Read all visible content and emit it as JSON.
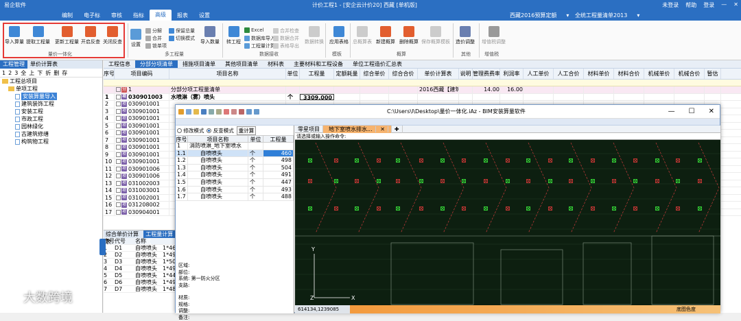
{
  "titlebar": {
    "app": "易企软件",
    "center": "计价工程1 - [安企云计价20] 西藏 [单机版]",
    "right": [
      "未登录",
      "帮助",
      "登录",
      "我的云",
      "最小化",
      "关闭"
    ]
  },
  "menubar": {
    "items": [
      "编制",
      "电子标",
      "审核",
      "指标",
      "报表",
      "设置"
    ],
    "active_index": 4,
    "active_label": "报表",
    "right_tabs": [
      "高级"
    ],
    "quota": "西藏2016预算定额",
    "list": "全统工程量清单2013"
  },
  "ribbon": {
    "group1_label": "量价一体化",
    "group1_buttons": [
      "导入算量",
      "提取工程量",
      "更新工程量",
      "开启反查",
      "关闭反查"
    ],
    "small1": [
      "分解",
      "合并",
      "锁单项"
    ],
    "setup": "设置",
    "group2_items": [
      "保留总量",
      "切换模式"
    ],
    "import_qty": "导入数量",
    "group2_label": "多工程量",
    "convert": "转工程",
    "excel_items": [
      "Excel",
      "数据库导入",
      "工程量计算",
      "合并检查",
      "数据合并",
      "表格导出"
    ],
    "group3_label": "数据接收",
    "small3": [
      "合并检查",
      "数据合并",
      "表格导出"
    ],
    "data_convert": "数据转换",
    "apply_table": "应用表格",
    "group4_label": "模板",
    "total_sheet": "总概算表",
    "new_sheet": "新建概算",
    "del_sheet": "删除概算",
    "save_sheet": "保存概算模板",
    "group5_label": "概算",
    "price_adjust": "造价调整",
    "group6_label": "其他",
    "add_cost": "增值税调整",
    "group7_label": "增值税"
  },
  "leftpanel": {
    "tabs": [
      "工程管理",
      "单价计算表"
    ],
    "tools": [
      "1",
      "2",
      "3",
      "全",
      "上",
      "下",
      "折",
      "删",
      "存"
    ],
    "tree": [
      {
        "label": "工程总项目",
        "level": 0,
        "icon": "folder-icon"
      },
      {
        "label": "单项工程",
        "level": 1,
        "icon": "folder-icon"
      },
      {
        "label": "安装算量导入",
        "level": 2,
        "icon": "doc-icon",
        "selected": true
      },
      {
        "label": "建筑装饰工程",
        "level": 2,
        "icon": "doc-icon"
      },
      {
        "label": "安装工程",
        "level": 2,
        "icon": "doc-icon"
      },
      {
        "label": "市政工程",
        "level": 2,
        "icon": "doc-icon"
      },
      {
        "label": "园林绿化",
        "level": 2,
        "icon": "doc-icon"
      },
      {
        "label": "古建筑修缮",
        "level": 2,
        "icon": "doc-icon"
      },
      {
        "label": "构筑物工程",
        "level": 2,
        "icon": "doc-icon"
      }
    ]
  },
  "main": {
    "tabs": [
      "工程信息",
      "分部分项清单",
      "措施项目清单",
      "其他项目清单",
      "材料表",
      "主要材料和工程设备",
      "单位工程造价汇总表"
    ],
    "active_tab": 1,
    "headers": [
      "序号",
      "项目编码",
      "项目名称",
      "单位",
      "工程量",
      "定额耗量",
      "综合单价",
      "综合合价",
      "单价计算表",
      "说明",
      "管理费费率",
      "利润率",
      "人工单价",
      "人工合价",
      "材料单价",
      "材料合价",
      "机械单价",
      "机械合价",
      "暂估"
    ],
    "rows": [
      {
        "no": "",
        "code": "1",
        "name": "分部分项工程量清单",
        "unit": "",
        "qty": "",
        "tag": "2016西藏【建筑装",
        "mgmt": "14.00",
        "profit": "16.00",
        "style": "pink",
        "badge": "分"
      },
      {
        "no": "1",
        "code": "030901003",
        "name": "水喷淋（雾）喷头",
        "unit": "个",
        "qty": "3309.000",
        "style": "bold",
        "badge": "项"
      },
      {
        "no": "2",
        "code": "030901001",
        "name": "",
        "unit": "",
        "qty": "",
        "badge": "项"
      },
      {
        "no": "3",
        "code": "030901001",
        "name": "",
        "unit": "",
        "qty": "",
        "badge": "项"
      },
      {
        "no": "4",
        "code": "030901001",
        "name": "",
        "unit": "",
        "qty": "",
        "badge": "项"
      },
      {
        "no": "5",
        "code": "030901001",
        "name": "",
        "unit": "",
        "qty": "",
        "badge": "项"
      },
      {
        "no": "6",
        "code": "030901001",
        "name": "",
        "unit": "",
        "qty": "",
        "badge": "项"
      },
      {
        "no": "7",
        "code": "030901001",
        "name": "",
        "unit": "",
        "qty": "",
        "badge": "项"
      },
      {
        "no": "8",
        "code": "030901001",
        "name": "",
        "unit": "",
        "qty": "",
        "badge": "项"
      },
      {
        "no": "9",
        "code": "030901001",
        "name": "",
        "unit": "",
        "qty": "",
        "badge": "项"
      },
      {
        "no": "10",
        "code": "030901001",
        "name": "",
        "unit": "",
        "qty": "",
        "badge": "项"
      },
      {
        "no": "11",
        "code": "030901006",
        "name": "",
        "unit": "",
        "qty": "",
        "badge": "项"
      },
      {
        "no": "12",
        "code": "030901006",
        "name": "",
        "unit": "",
        "qty": "",
        "badge": "项"
      },
      {
        "no": "13",
        "code": "031002003",
        "name": "",
        "unit": "",
        "qty": "",
        "badge": "项"
      },
      {
        "no": "14",
        "code": "031003001",
        "name": "",
        "unit": "",
        "qty": "",
        "badge": "项"
      },
      {
        "no": "15",
        "code": "031002001",
        "name": "",
        "unit": "",
        "qty": "",
        "badge": "项"
      },
      {
        "no": "16",
        "code": "031208002",
        "name": "",
        "unit": "",
        "qty": "",
        "badge": "项"
      },
      {
        "no": "17",
        "code": "030904001",
        "name": "",
        "unit": "",
        "qty": "",
        "badge": "项"
      }
    ]
  },
  "bottomleft": {
    "tabs": [
      "综合单价计算表",
      "工程量计算式"
    ],
    "headers": [
      "序号",
      "代号",
      "名称"
    ],
    "rows": [
      {
        "no": "1",
        "code": "D1",
        "name": "自喷喷头",
        "val": "1*460"
      },
      {
        "no": "2",
        "code": "D2",
        "name": "自喷喷头",
        "val": "1*498"
      },
      {
        "no": "3",
        "code": "D3",
        "name": "自喷喷头",
        "val": "1*504"
      },
      {
        "no": "4",
        "code": "D4",
        "name": "自喷喷头",
        "val": "1*491"
      },
      {
        "no": "5",
        "code": "D5",
        "name": "自喷喷头",
        "val": "1*447"
      },
      {
        "no": "6",
        "code": "D6",
        "name": "自喷喷头",
        "val": "1*493"
      },
      {
        "no": "7",
        "code": "D7",
        "name": "自喷喷头",
        "val": "1*488"
      }
    ]
  },
  "bim": {
    "title": "C:\\Users\\l\\Desktop\\量价一体化.iAz - BIM安装算量软件",
    "modes": [
      "修改模式",
      "反查模式"
    ],
    "calc_button": "重计算",
    "grid_headers": [
      "序号",
      "项目名称",
      "单位",
      "工程量"
    ],
    "group_row": {
      "no": "1",
      "name": "消防喷淋_地下室喷水",
      "unit": "",
      "qty": ""
    },
    "rows": [
      {
        "no": "1.1",
        "name": "自喷喷头",
        "unit": "个",
        "qty": "460"
      },
      {
        "no": "1.2",
        "name": "自喷喷头",
        "unit": "个",
        "qty": "498"
      },
      {
        "no": "1.3",
        "name": "自喷喷头",
        "unit": "个",
        "qty": "504"
      },
      {
        "no": "1.4",
        "name": "自喷喷头",
        "unit": "个",
        "qty": "491"
      },
      {
        "no": "1.5",
        "name": "自喷喷头",
        "unit": "个",
        "qty": "447"
      },
      {
        "no": "1.6",
        "name": "自喷喷头",
        "unit": "个",
        "qty": "493"
      },
      {
        "no": "1.7",
        "name": "自喷喷头",
        "unit": "个",
        "qty": "488"
      }
    ],
    "info_lines": [
      "区域:",
      "部位:",
      "系统: 第一防火分区",
      "支路:",
      "",
      "材质:",
      "规格:",
      "调整:",
      "备注:"
    ],
    "cad_tabs": [
      "零星项目",
      "地下室喷水排水..."
    ],
    "cad_prompt": "请选择或输入操作命令:",
    "coords": "614134,1239085",
    "status_right": "底图色度",
    "axis_y": "Y",
    "axis_x": "X",
    "axis_z": "Z"
  },
  "watermark": "大数跨境"
}
